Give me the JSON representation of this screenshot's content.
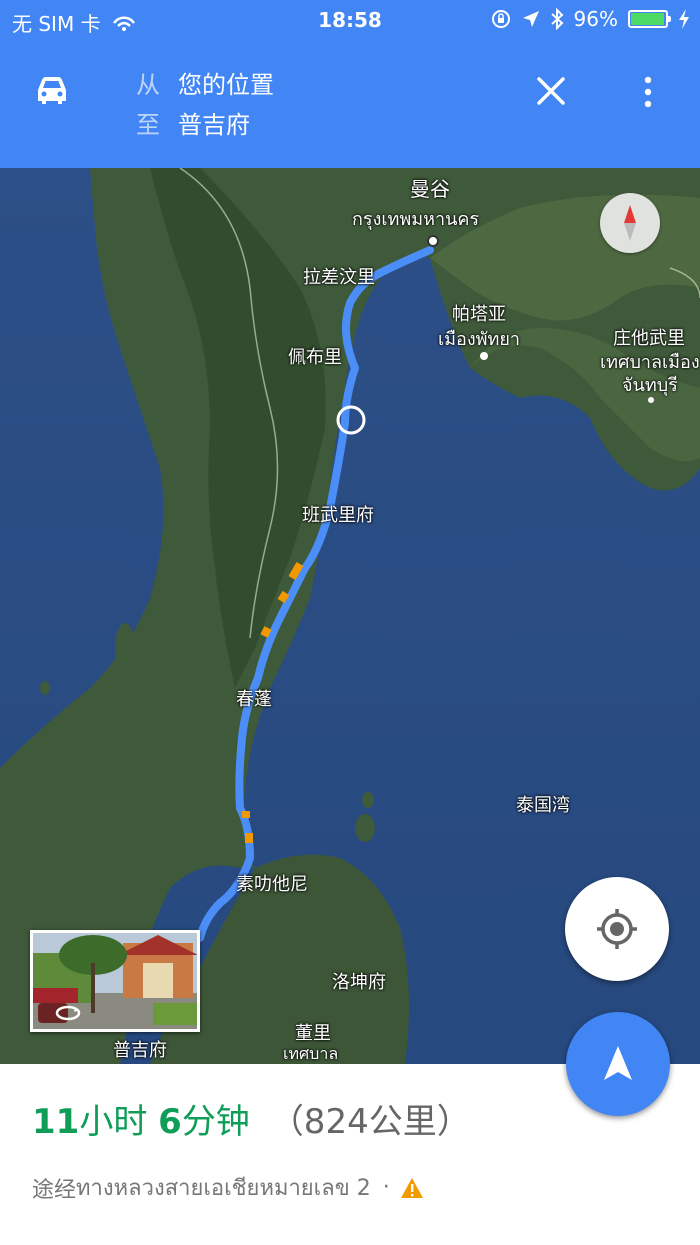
{
  "status_bar": {
    "carrier": "无 SIM 卡",
    "time": "18:58",
    "battery_percent": "96%",
    "battery_level": 0.96
  },
  "directions_header": {
    "mode_icon": "car-icon",
    "from_prefix": "从",
    "from_value": "您的位置",
    "to_prefix": "至",
    "to_value": "普吉府"
  },
  "map": {
    "labels": {
      "bangkok_cn": "曼谷",
      "bangkok_th": "กรุงเทพมหานคร",
      "ratchaburi": "拉差汶里",
      "pattaya_cn": "帕塔亚",
      "pattaya_th": "เมืองพัทยา",
      "chanthaburi_cn": "庄他武里",
      "chanthaburi_th1": "เทศบาลเมือง",
      "chanthaburi_th2": "จันทบุรี",
      "phetchaburi": "佩布里",
      "prachuap": "班武里府",
      "chumphon": "春蓬",
      "gulf": "泰国湾",
      "surat_thani": "素叻他尼",
      "nakhon_si": "洛坤府",
      "phuket": "普吉府",
      "trang_cn": "董里",
      "trang_th": "เทศบาล"
    }
  },
  "route_summary": {
    "hours": "11",
    "hours_unit": "小时",
    "minutes": "6",
    "minutes_unit": "分钟",
    "distance": "（824公里）",
    "via_prefix": "途经",
    "via_road": "ทางหลวงสายเอเชียหมายเลข 2",
    "separator": "·"
  },
  "colors": {
    "accent": "#4285f4",
    "eta_green": "#0f9d58",
    "route_blue": "#4c8ef7",
    "traffic_orange": "#f29900"
  }
}
